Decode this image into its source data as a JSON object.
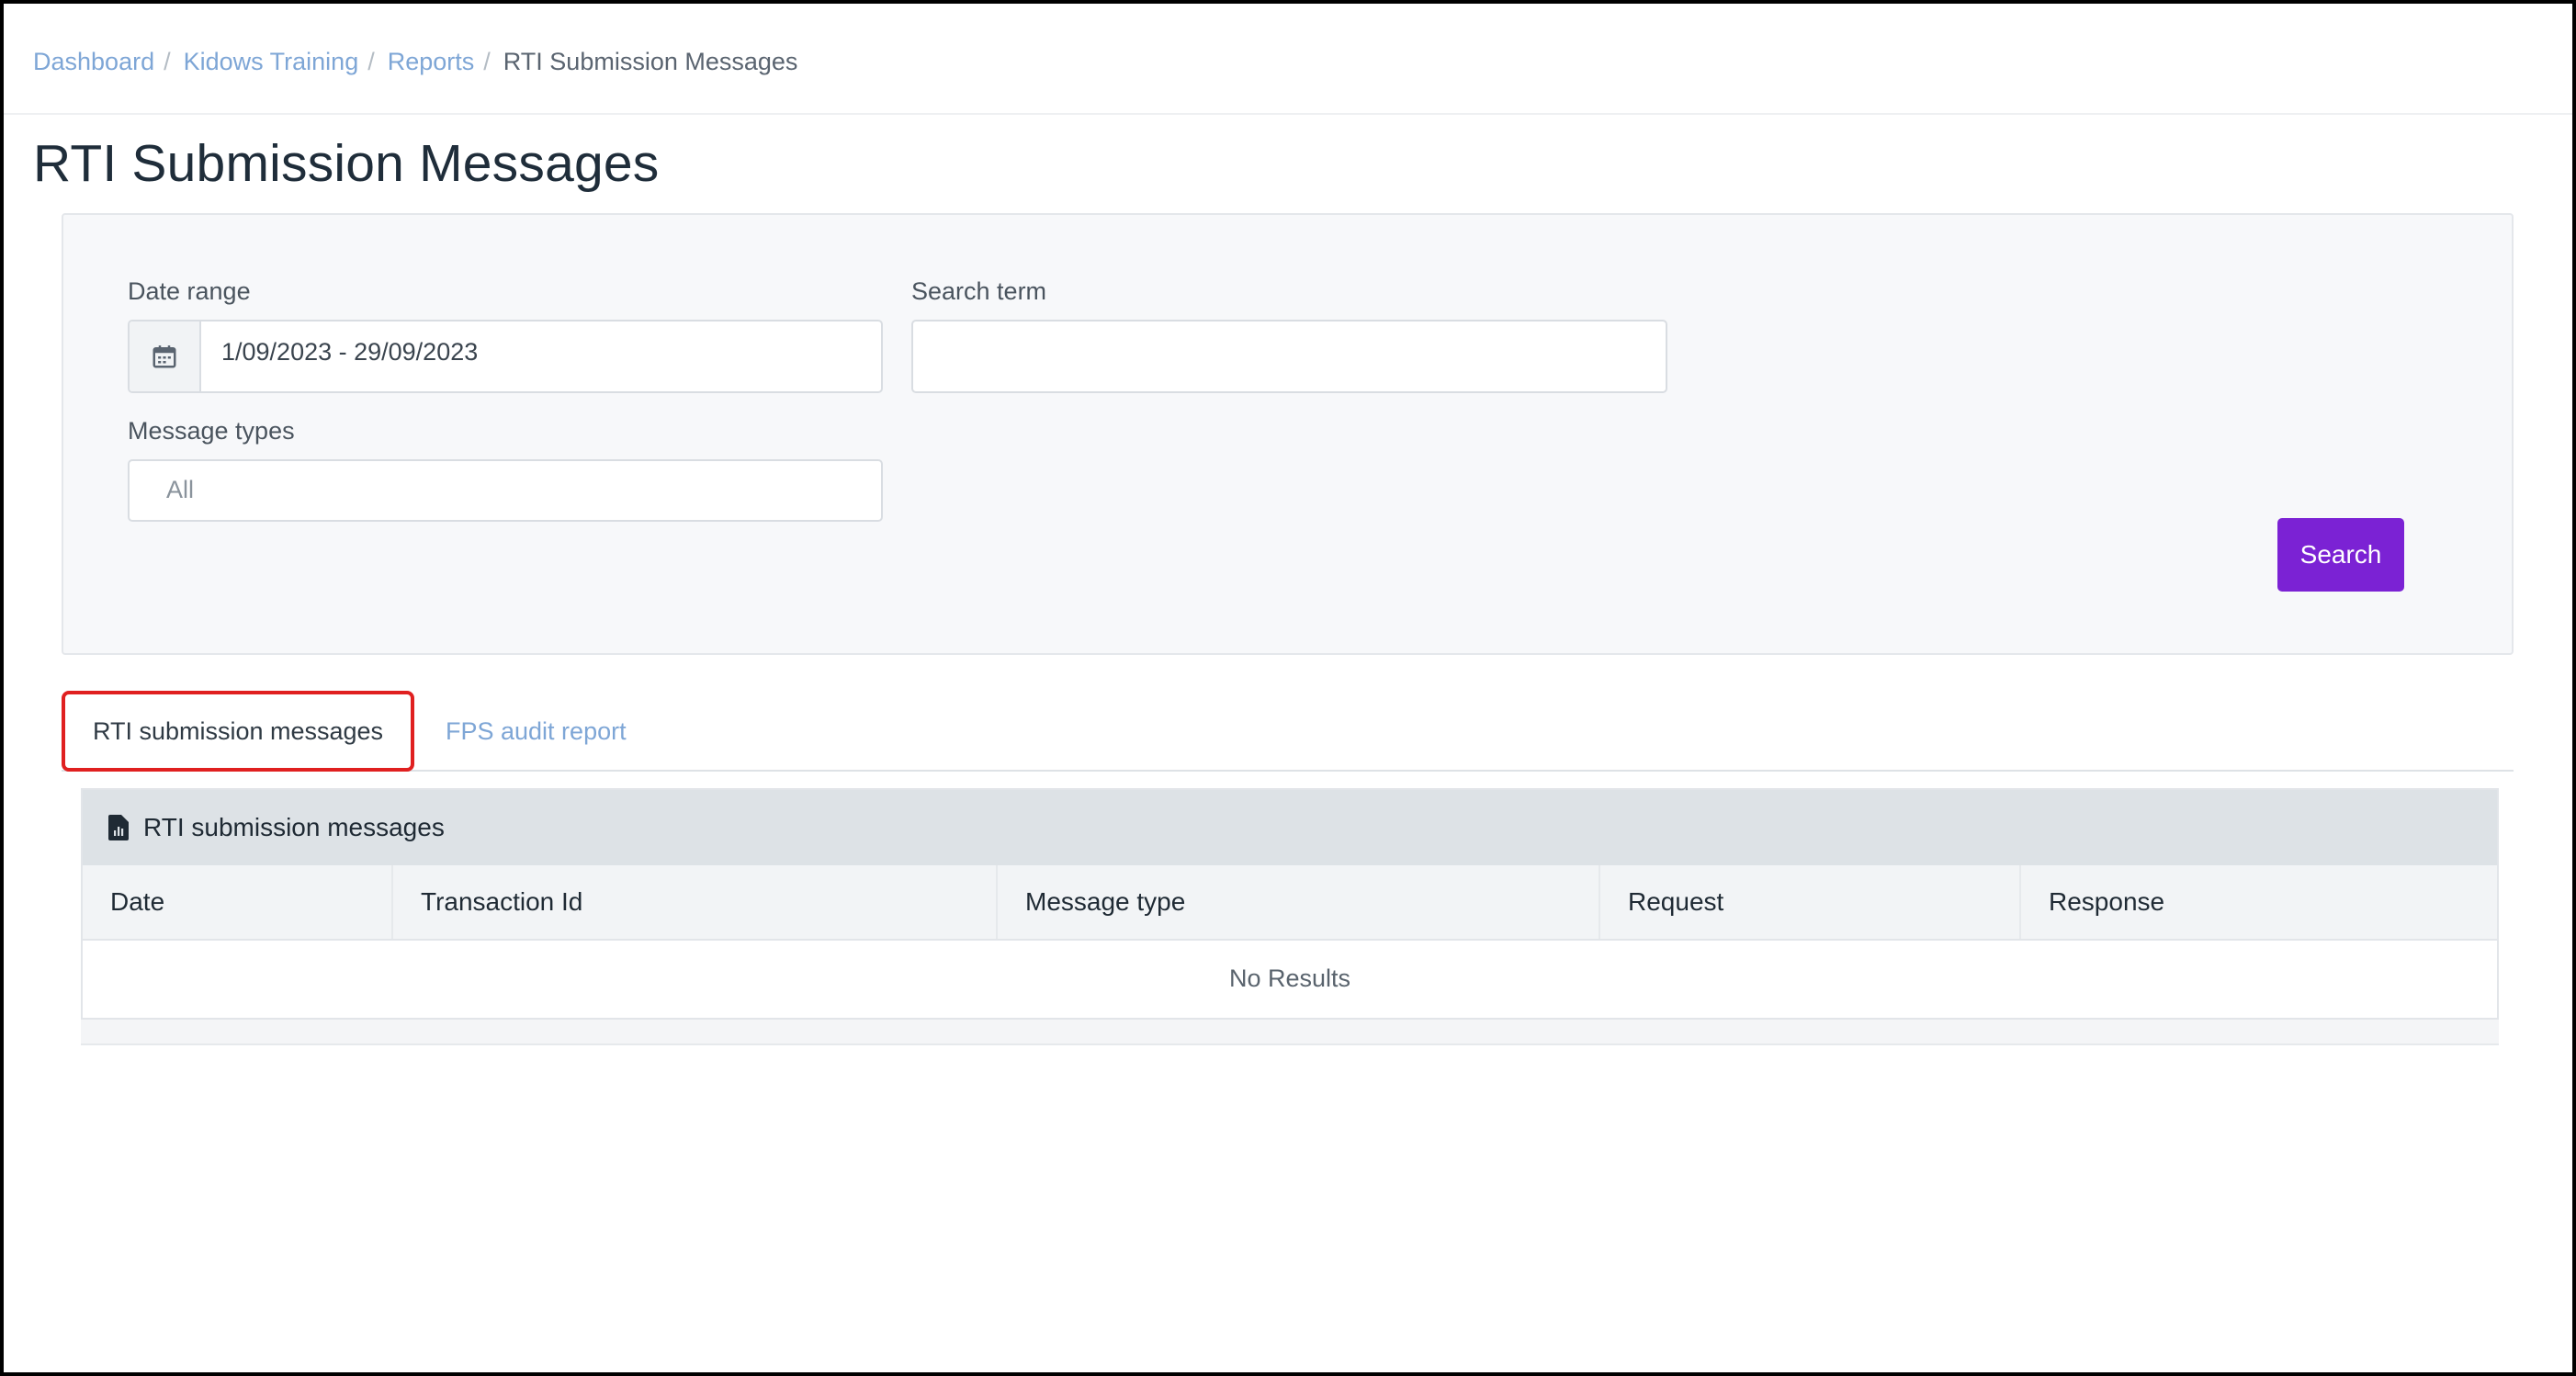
{
  "breadcrumb": {
    "items": [
      "Dashboard",
      "Kidows Training",
      "Reports"
    ],
    "current": "RTI Submission Messages",
    "separator": "/"
  },
  "page": {
    "title": "RTI Submission Messages"
  },
  "filters": {
    "date_range": {
      "label": "Date range",
      "value": "1/09/2023 - 29/09/2023",
      "icon": "calendar-icon"
    },
    "search_term": {
      "label": "Search term",
      "value": "",
      "placeholder": ""
    },
    "message_types": {
      "label": "Message types",
      "value": "All"
    },
    "search_button": "Search"
  },
  "tabs": [
    {
      "label": "RTI submission messages",
      "active": true
    },
    {
      "label": "FPS audit report",
      "active": false
    }
  ],
  "table": {
    "title": "RTI submission messages",
    "icon": "report-document-icon",
    "columns": [
      "Date",
      "Transaction Id",
      "Message type",
      "Request",
      "Response"
    ],
    "empty_text": "No Results"
  },
  "colors": {
    "accent": "#7b22d4",
    "link": "#7ea6d6",
    "highlight": "#e02020"
  }
}
